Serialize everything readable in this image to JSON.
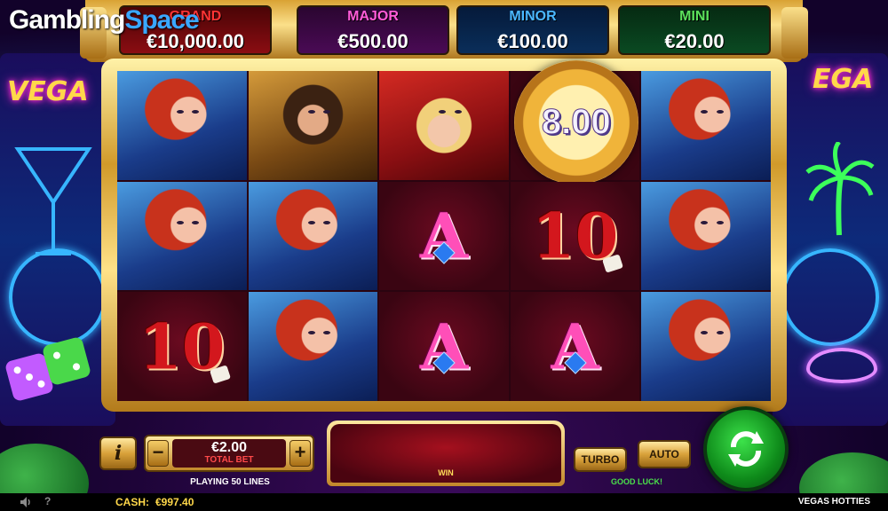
{
  "watermark": {
    "part1": "Gambling",
    "part2": "Space"
  },
  "jackpots": [
    {
      "name": "GRAND",
      "amount": "€10,000.00"
    },
    {
      "name": "MAJOR",
      "amount": "€500.00"
    },
    {
      "name": "MINOR",
      "amount": "€100.00"
    },
    {
      "name": "MINI",
      "amount": "€20.00"
    }
  ],
  "background_signs": {
    "left": "VEGA",
    "right": "EGA"
  },
  "reels": {
    "grid": [
      [
        "redhead",
        "brunette",
        "blonde",
        "chip",
        "redhead"
      ],
      [
        "redhead",
        "redhead",
        "A",
        "10",
        "redhead"
      ],
      [
        "10",
        "redhead",
        "A",
        "A",
        "redhead"
      ]
    ],
    "symbol_text": {
      "ten": "10",
      "ace": "A"
    },
    "chip_value": "8.00"
  },
  "controls": {
    "info_label": "i",
    "minus_label": "−",
    "plus_label": "+",
    "total_bet_value": "€2.00",
    "total_bet_label": "TOTAL BET",
    "lines_text": "PLAYING 50 LINES",
    "win_label": "WIN",
    "turbo_label": "TURBO",
    "auto_label": "AUTO",
    "good_luck": "GOOD LUCK!"
  },
  "status_bar": {
    "help_label": "?",
    "cash_label": "CASH:",
    "cash_value": "€997.40",
    "game_name": "VEGAS HOTTIES"
  },
  "colors": {
    "gold": "#d9a234",
    "grand": "#ff3434",
    "major": "#ff5bd8",
    "minor": "#4ab8ff",
    "mini": "#5be05b",
    "spin_green": "#0e8a1a"
  }
}
